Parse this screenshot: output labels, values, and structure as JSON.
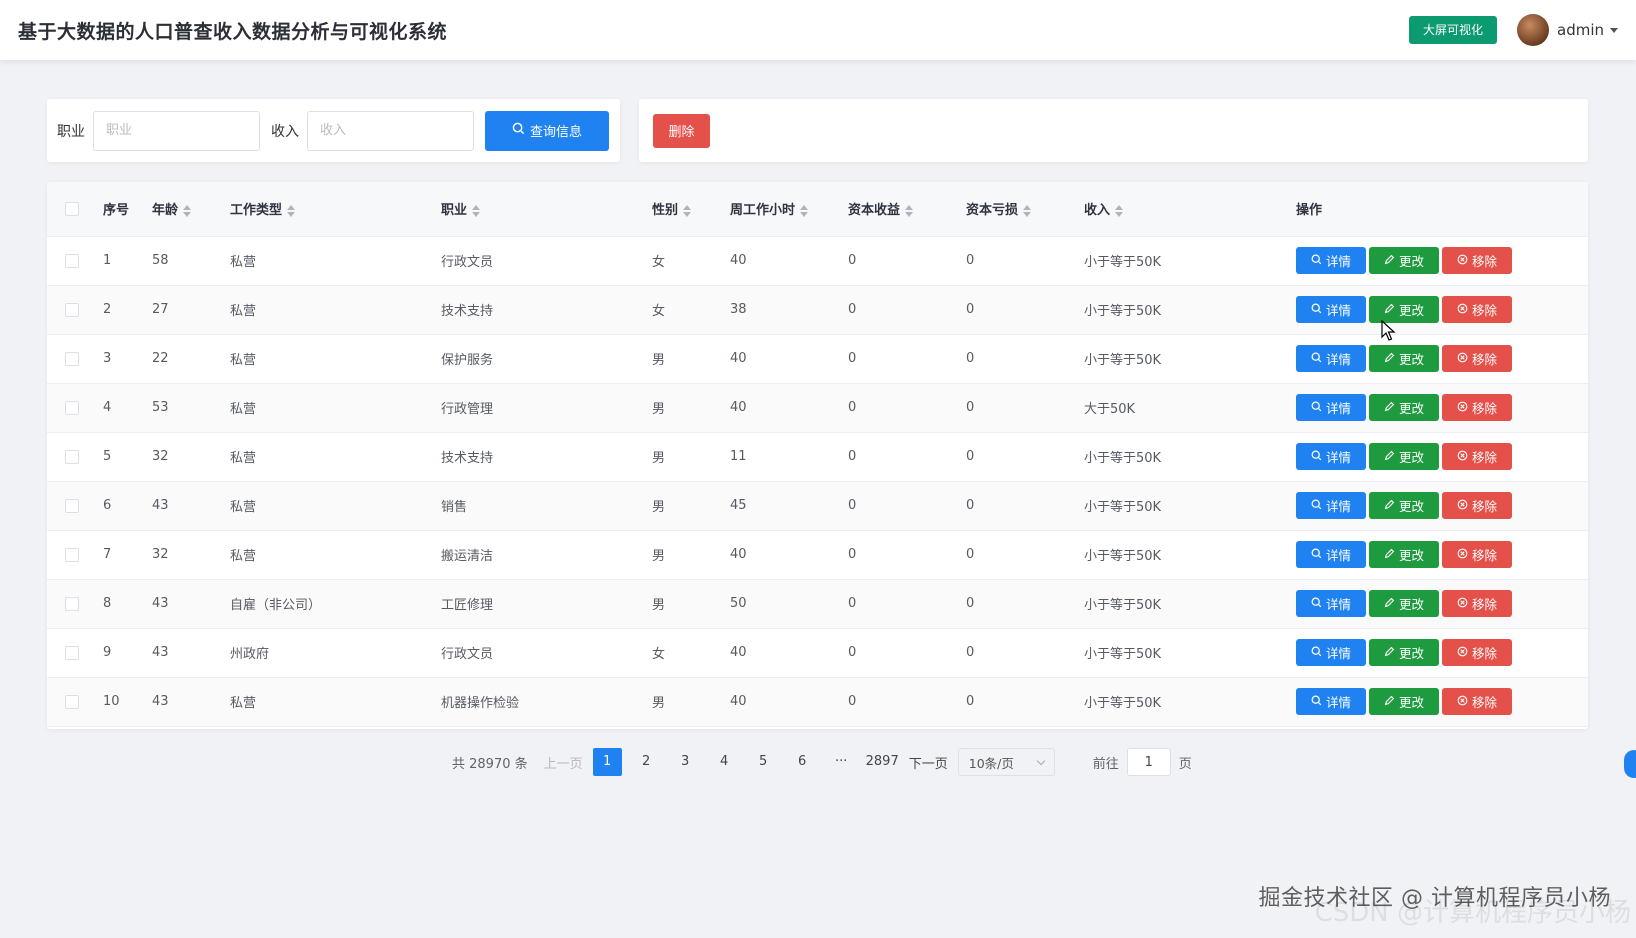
{
  "header": {
    "title": "基于大数据的人口普查收入数据分析与可视化系统",
    "bigscreen_label": "大屏可视化",
    "user_name": "admin"
  },
  "search": {
    "occupation_label": "职业",
    "occupation_placeholder": "职业",
    "income_label": "收入",
    "income_placeholder": "收入",
    "query_label": "查询信息"
  },
  "actions": {
    "delete_label": "删除"
  },
  "table": {
    "columns": [
      "序号",
      "年龄",
      "工作类型",
      "职业",
      "性别",
      "周工作小时",
      "资本收益",
      "资本亏损",
      "收入",
      "操作"
    ],
    "op_labels": {
      "detail": "详情",
      "edit": "更改",
      "remove": "移除"
    },
    "rows": [
      {
        "id": "1",
        "age": "58",
        "workclass": "私营",
        "occupation": "行政文员",
        "sex": "女",
        "hours": "40",
        "gain": "0",
        "loss": "0",
        "income": "小于等于50K"
      },
      {
        "id": "2",
        "age": "27",
        "workclass": "私营",
        "occupation": "技术支持",
        "sex": "女",
        "hours": "38",
        "gain": "0",
        "loss": "0",
        "income": "小于等于50K"
      },
      {
        "id": "3",
        "age": "22",
        "workclass": "私营",
        "occupation": "保护服务",
        "sex": "男",
        "hours": "40",
        "gain": "0",
        "loss": "0",
        "income": "小于等于50K"
      },
      {
        "id": "4",
        "age": "53",
        "workclass": "私营",
        "occupation": "行政管理",
        "sex": "男",
        "hours": "40",
        "gain": "0",
        "loss": "0",
        "income": "大于50K"
      },
      {
        "id": "5",
        "age": "32",
        "workclass": "私营",
        "occupation": "技术支持",
        "sex": "男",
        "hours": "11",
        "gain": "0",
        "loss": "0",
        "income": "小于等于50K"
      },
      {
        "id": "6",
        "age": "43",
        "workclass": "私营",
        "occupation": "销售",
        "sex": "男",
        "hours": "45",
        "gain": "0",
        "loss": "0",
        "income": "小于等于50K"
      },
      {
        "id": "7",
        "age": "32",
        "workclass": "私营",
        "occupation": "搬运清洁",
        "sex": "男",
        "hours": "40",
        "gain": "0",
        "loss": "0",
        "income": "小于等于50K"
      },
      {
        "id": "8",
        "age": "43",
        "workclass": "自雇（非公司）",
        "occupation": "工匠修理",
        "sex": "男",
        "hours": "50",
        "gain": "0",
        "loss": "0",
        "income": "小于等于50K"
      },
      {
        "id": "9",
        "age": "43",
        "workclass": "州政府",
        "occupation": "行政文员",
        "sex": "女",
        "hours": "40",
        "gain": "0",
        "loss": "0",
        "income": "小于等于50K"
      },
      {
        "id": "10",
        "age": "43",
        "workclass": "私营",
        "occupation": "机器操作检验",
        "sex": "男",
        "hours": "40",
        "gain": "0",
        "loss": "0",
        "income": "小于等于50K"
      }
    ]
  },
  "pagination": {
    "total_text": "共 28970 条",
    "prev_label": "上一页",
    "pages": [
      "1",
      "2",
      "3",
      "4",
      "5",
      "6"
    ],
    "ellipsis": "···",
    "last_page": "2897",
    "next_label": "下一页",
    "page_size": "10条/页",
    "goto_label": "前往",
    "goto_value": "1",
    "goto_suffix": "页"
  },
  "watermark": {
    "line1": "掘金技术社区 @ 计算机程序员小杨",
    "line2": "CSDN @计算机程序员小杨"
  },
  "colors": {
    "primary": "#1f82f0",
    "success": "#1f9b3f",
    "danger": "#e4504a",
    "bigscreen": "#0c9a70"
  }
}
